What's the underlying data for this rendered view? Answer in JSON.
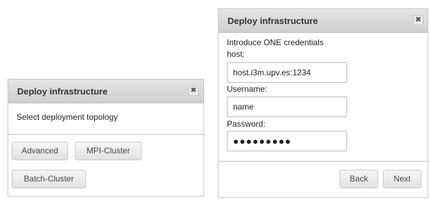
{
  "left_dialog": {
    "title": "Deploy infrastructure",
    "close_label": "✖",
    "prompt": "Select deployment topology",
    "buttons": {
      "advanced": "Advanced",
      "mpi_cluster": "MPI-Cluster",
      "batch_cluster": "Batch-Cluster"
    }
  },
  "right_dialog": {
    "title": "Deploy infrastructure",
    "close_label": "✖",
    "intro": "Introduce ONE credentials",
    "host_label": "host:",
    "host_value": "host.i3m.upv.es:1234",
    "username_label": "Username:",
    "username_value": "name",
    "password_label": "Password:",
    "password_value": "●●●●●●●●●",
    "buttons": {
      "back": "Back",
      "next": "Next"
    }
  }
}
